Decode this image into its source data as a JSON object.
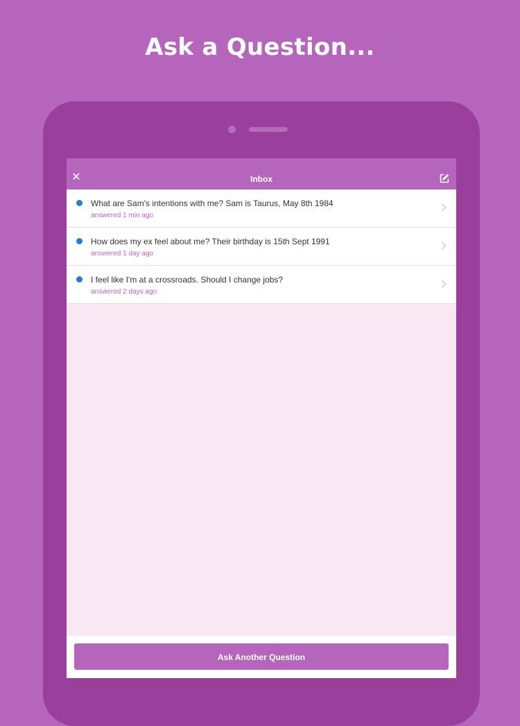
{
  "headline": "Ask a Question...",
  "colors": {
    "background": "#b565bc",
    "device": "#9b3f9c",
    "accent": "#b565bc",
    "unread_dot": "#1e7ee0",
    "screen_background": "#f7e8f4"
  },
  "navbar": {
    "title": "Inbox",
    "close_icon": "close-icon",
    "compose_icon": "compose-icon"
  },
  "questions": [
    {
      "text": "What are Sam's intentions with me? Sam is Taurus, May 8th 1984",
      "meta": "answered 1 min ago",
      "unread": true
    },
    {
      "text": "How does my ex feel about me? Their birthday is 15th Sept 1991",
      "meta": "answered 1 day ago",
      "unread": true
    },
    {
      "text": "I feel like I'm at a crossroads. Should I change jobs?",
      "meta": "answered 2 days ago",
      "unread": true
    }
  ],
  "footer": {
    "ask_button_label": "Ask Another Question"
  }
}
